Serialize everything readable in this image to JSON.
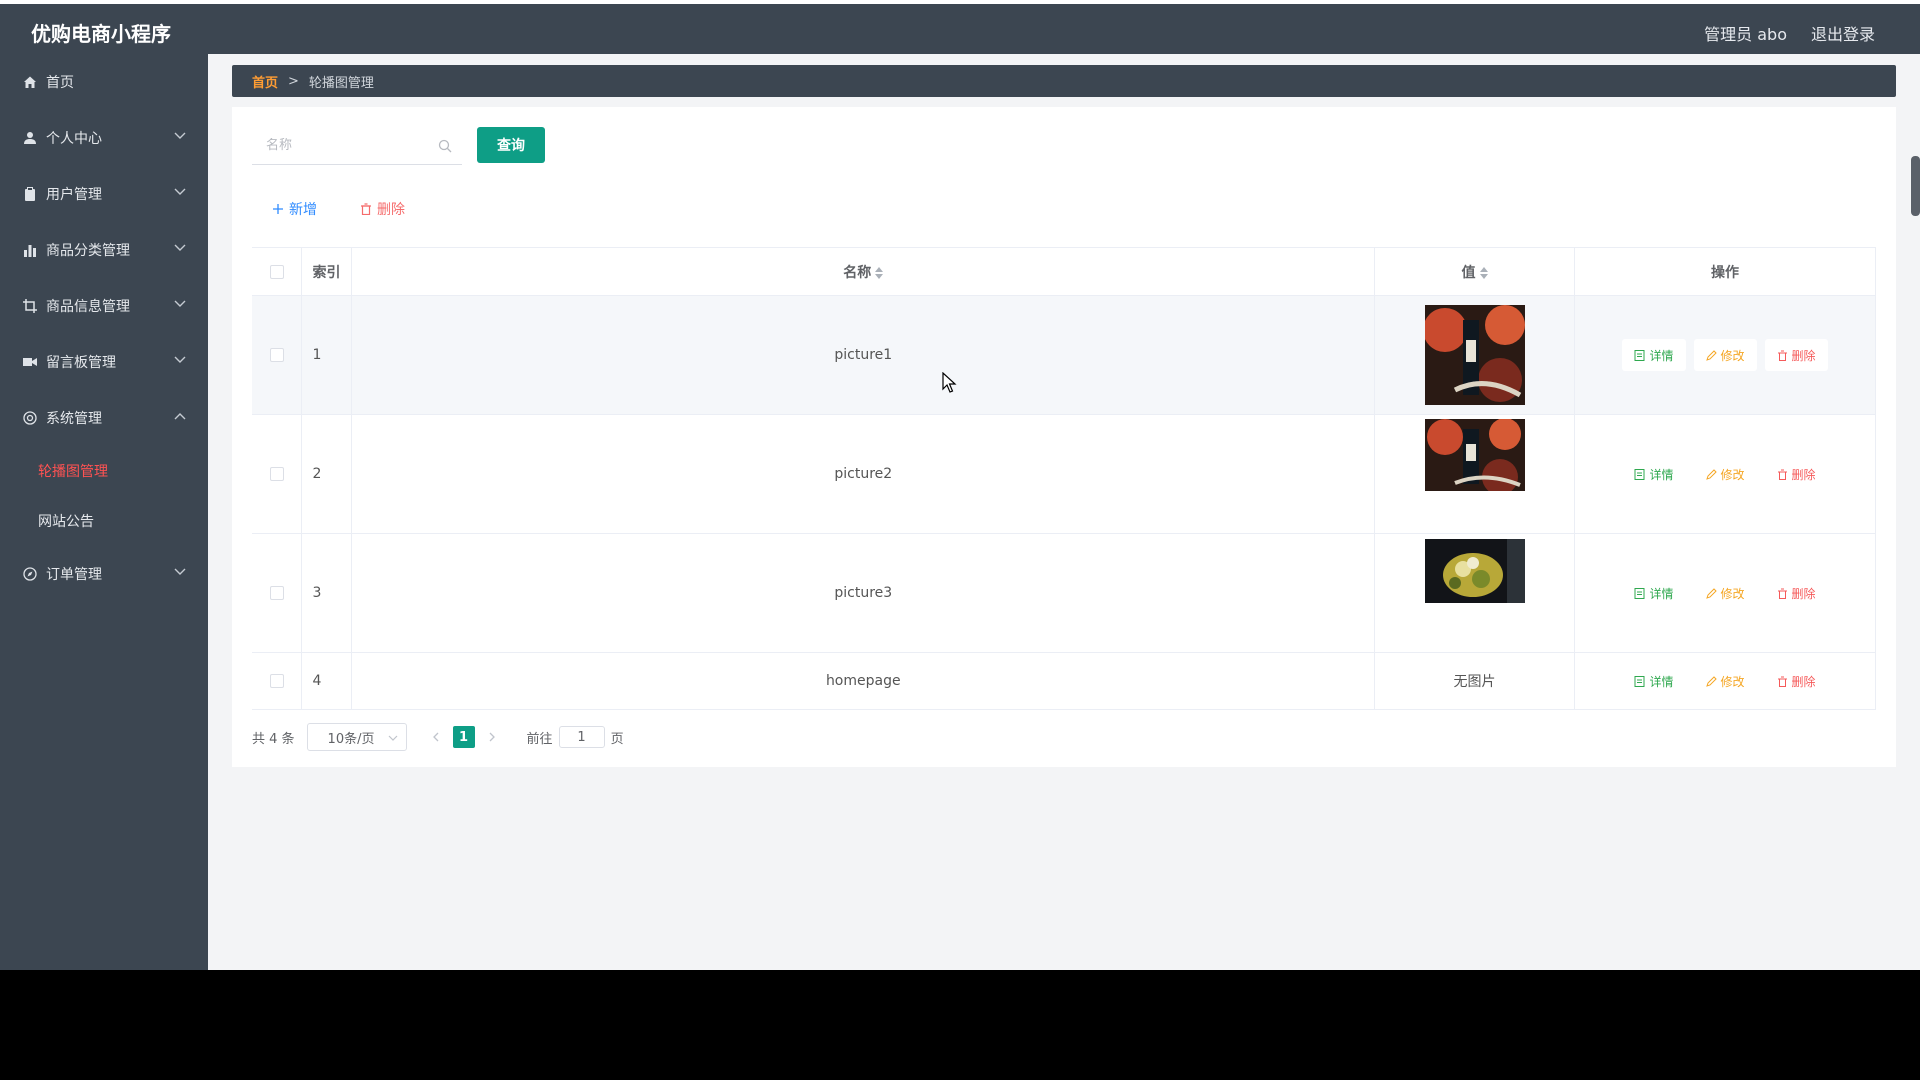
{
  "app": {
    "title": "优购电商小程序",
    "user_label": "管理员 abo",
    "logout": "退出登录"
  },
  "sidebar": {
    "items": [
      {
        "label": "首页",
        "icon": "home-icon"
      },
      {
        "label": "个人中心",
        "icon": "user-icon"
      },
      {
        "label": "用户管理",
        "icon": "clipboard-icon"
      },
      {
        "label": "商品分类管理",
        "icon": "bar-chart-icon"
      },
      {
        "label": "商品信息管理",
        "icon": "crop-icon"
      },
      {
        "label": "留言板管理",
        "icon": "video-icon"
      },
      {
        "label": "系统管理",
        "icon": "settings-icon"
      },
      {
        "label": "订单管理",
        "icon": "compass-icon"
      }
    ],
    "sub": [
      "轮播图管理",
      "网站公告"
    ]
  },
  "breadcrumb": {
    "home": "首页",
    "separator": ">",
    "current": "轮播图管理"
  },
  "search": {
    "placeholder": "名称",
    "query_button": "查询"
  },
  "actions": {
    "add": "新增",
    "delete": "删除"
  },
  "table": {
    "headers": {
      "index": "索引",
      "name": "名称",
      "value": "值",
      "ops": "操作"
    },
    "rows": [
      {
        "index": "1",
        "name": "picture1",
        "value": ""
      },
      {
        "index": "2",
        "name": "picture2",
        "value": ""
      },
      {
        "index": "3",
        "name": "picture3",
        "value": ""
      },
      {
        "index": "4",
        "name": "homepage",
        "value": "无图片"
      }
    ],
    "ops": {
      "detail": "详情",
      "edit": "修改",
      "remove": "删除"
    }
  },
  "pagination": {
    "total": "共 4 条",
    "page_size": "10条/页",
    "current_page": "1",
    "goto_prefix": "前往",
    "goto_value": "1",
    "goto_suffix": "页"
  },
  "colors": {
    "sidebar_bg": "#3c4651",
    "primary": "#0e9e86",
    "active_menu": "#ff5252",
    "breadcrumb_home": "#ff9d33"
  }
}
